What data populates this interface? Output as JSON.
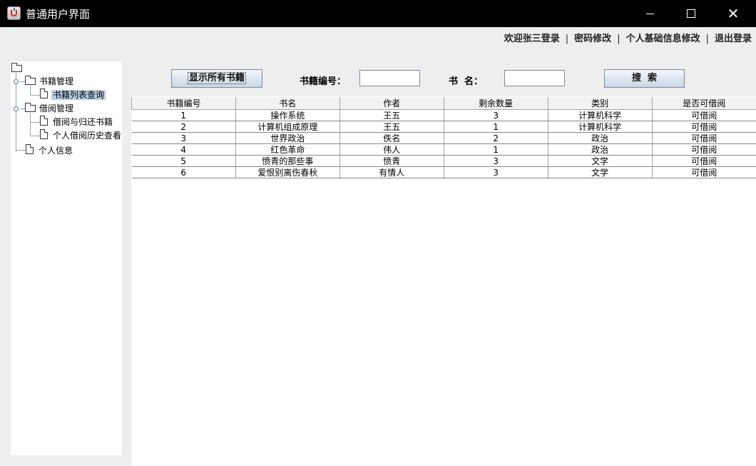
{
  "window": {
    "title": "普通用户界面",
    "controls": [
      "minimize",
      "maximize",
      "close"
    ]
  },
  "top_menu": {
    "welcome": "欢迎张三登录",
    "change_password": "密码修改",
    "edit_profile": "个人基础信息修改",
    "logout": "退出登录",
    "separator": "|"
  },
  "tree": {
    "book_mgmt": "书籍管理",
    "book_list_query": "书籍列表查询",
    "borrow_mgmt": "借阅管理",
    "borrow_return": "借阅与归还书籍",
    "borrow_history": "个人借阅历史查看",
    "personal_info": "个人信息"
  },
  "toolbar": {
    "show_all_label": "显示所有书籍",
    "book_id_label": "书籍编号：",
    "book_id_value": "",
    "book_name_label": "书  名：",
    "book_name_value": "",
    "search_label": "搜  索"
  },
  "table": {
    "columns": [
      "书籍编号",
      "书名",
      "作者",
      "剩余数量",
      "类别",
      "是否可借阅"
    ],
    "rows": [
      [
        "1",
        "操作系统",
        "王五",
        "3",
        "计算机科学",
        "可借阅"
      ],
      [
        "2",
        "计算机组成原理",
        "王五",
        "1",
        "计算机科学",
        "可借阅"
      ],
      [
        "3",
        "世界政治",
        "佚名",
        "2",
        "政治",
        "可借阅"
      ],
      [
        "4",
        "红色革命",
        "伟人",
        "1",
        "政治",
        "可借阅"
      ],
      [
        "5",
        "愤青的那些事",
        "愤青",
        "3",
        "文学",
        "可借阅"
      ],
      [
        "6",
        "爱恨别离伤春秋",
        "有情人",
        "3",
        "文学",
        "可借阅"
      ]
    ]
  }
}
